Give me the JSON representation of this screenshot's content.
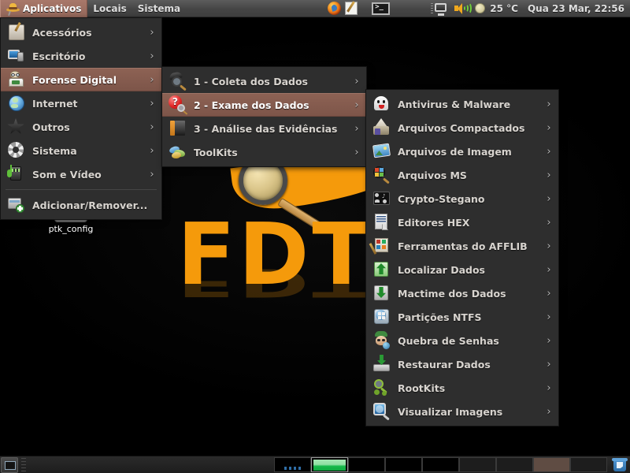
{
  "top_panel": {
    "menus": [
      {
        "label": "Aplicativos",
        "icon": "fedora-hat-icon",
        "active": true
      },
      {
        "label": "Locais",
        "icon": null,
        "active": false
      },
      {
        "label": "Sistema",
        "icon": null,
        "active": false
      }
    ],
    "launchers": [
      {
        "name": "firefox-icon",
        "label": "Firefox"
      },
      {
        "name": "text-editor-icon",
        "label": "Editor de Texto"
      },
      {
        "name": "terminal-icon",
        "label": "Terminal"
      }
    ],
    "tray": {
      "network_monitor_icon": "network-monitor-icon",
      "volume_icon": "volume-icon",
      "weather_icon": "moon-icon",
      "temperature": "25 °C",
      "clock": "Qua 23 Mar, 22:56"
    }
  },
  "menu_applications": {
    "items": [
      {
        "label": "Acessórios",
        "icon": "accessories-icon",
        "arrow": "›",
        "selected": false,
        "color1": "#e9e4da",
        "color2": "#b9b0a2"
      },
      {
        "label": "Escritório",
        "icon": "office-icon",
        "arrow": "›",
        "selected": false,
        "color1": "#4a9fe0",
        "color2": "#1c5b94"
      },
      {
        "label": "Forense Digital",
        "icon": "forensics-icon",
        "arrow": "›",
        "selected": true,
        "color1": "#d8cbb4",
        "color2": "#8c7452"
      },
      {
        "label": "Internet",
        "icon": "internet-globe-icon",
        "arrow": "›",
        "selected": false,
        "color1": "#9fd2f2",
        "color2": "#2a6fa8"
      },
      {
        "label": "Outros",
        "icon": "star-icon",
        "arrow": "›",
        "selected": false,
        "color1": "#4a4a4a",
        "color2": "#161616"
      },
      {
        "label": "Sistema",
        "icon": "gear-icon",
        "arrow": "›",
        "selected": false,
        "color1": "#efefef",
        "color2": "#a9a9a9"
      },
      {
        "label": "Som e Vídeo",
        "icon": "sound-video-icon",
        "arrow": "›",
        "selected": false,
        "color1": "#7fc45a",
        "color2": "#2d6b2d"
      }
    ],
    "separator_after_index": 6,
    "footer_item": {
      "label": "Adicionar/Remover...",
      "icon": "add-remove-icon",
      "arrow": "",
      "selected": false,
      "color1": "#d6d6d6",
      "color2": "#8f8f8f"
    }
  },
  "menu_forense_digital": {
    "items": [
      {
        "label": "1 - Coleta dos Dados",
        "icon": "collect-data-icon",
        "arrow": "›",
        "selected": false,
        "color1": "#4e4e4e",
        "color2": "#1c1c1c"
      },
      {
        "label": "2 - Exame dos Dados",
        "icon": "exam-data-icon",
        "arrow": "›",
        "selected": true,
        "color1": "#e23b3b",
        "color2": "#9c1111"
      },
      {
        "label": "3 - Análise das Evidências",
        "icon": "analysis-icon",
        "arrow": "›",
        "selected": false,
        "color1": "#e08a2a",
        "color2": "#4a4a4a"
      },
      {
        "label": "ToolKits",
        "icon": "toolkits-icon",
        "arrow": "›",
        "selected": false,
        "color1": "#7fb3e0",
        "color2": "#5a9a3a"
      }
    ]
  },
  "menu_exame_dos_dados": {
    "items": [
      {
        "label": "Antivirus & Malware",
        "icon": "ghost-icon",
        "arrow": "›",
        "color1": "#f2f2f2",
        "color2": "#c9c9c9"
      },
      {
        "label": "Arquivos Compactados",
        "icon": "archive-icon",
        "arrow": "›",
        "color1": "#e8e3d8",
        "color2": "#9b8d74"
      },
      {
        "label": "Arquivos de Imagem",
        "icon": "image-file-icon",
        "arrow": "›",
        "color1": "#73c6e8",
        "color2": "#3d7fb0"
      },
      {
        "label": "Arquivos MS",
        "icon": "ms-files-icon",
        "arrow": "›",
        "color1": "#9fd8f2",
        "color2": "#2f6f9f"
      },
      {
        "label": "Crypto-Stegano",
        "icon": "crypto-stegano-icon",
        "arrow": "›",
        "color1": "#3a3a3a",
        "color2": "#0e0e0e"
      },
      {
        "label": "Editores HEX",
        "icon": "hex-editor-icon",
        "arrow": "›",
        "color1": "#f1f1f1",
        "color2": "#cfcfcf"
      },
      {
        "label": "Ferramentas do AFFLIB",
        "icon": "afflib-tools-icon",
        "arrow": "›",
        "color1": "#e6e0d2",
        "color2": "#b04a3c"
      },
      {
        "label": "Localizar Dados",
        "icon": "find-data-icon",
        "arrow": "›",
        "color1": "#7fdf6a",
        "color2": "#2a8f2a"
      },
      {
        "label": "Mactime dos Dados",
        "icon": "mactime-icon",
        "arrow": "›",
        "color1": "#7fdf6a",
        "color2": "#2a8f2a"
      },
      {
        "label": "Partições NTFS",
        "icon": "ntfs-partitions-icon",
        "arrow": "›",
        "color1": "#bcd6e8",
        "color2": "#5a7f9c"
      },
      {
        "label": "Quebra de Senhas",
        "icon": "password-crack-icon",
        "arrow": "›",
        "color1": "#5ac46a",
        "color2": "#1f7a9c"
      },
      {
        "label": "Restaurar Dados",
        "icon": "restore-data-icon",
        "arrow": "›",
        "color1": "#d9d9d9",
        "color2": "#2a8f2a"
      },
      {
        "label": "RootKits",
        "icon": "rootkits-icon",
        "arrow": "›",
        "color1": "#8fbf3a",
        "color2": "#4a7a1a"
      },
      {
        "label": "Visualizar Imagens",
        "icon": "view-images-icon",
        "arrow": "›",
        "color1": "#5aa8e0",
        "color2": "#1d5f9c"
      }
    ]
  },
  "desktop": {
    "icons": [
      {
        "label": "ptk_config",
        "icon": "script-file-icon"
      }
    ],
    "wallpaper_logo_text": "FDTK",
    "accent_color": "#f59a0b"
  },
  "bottom_panel": {
    "show_desktop_icon": "show-desktop-icon",
    "workspaces": [
      {
        "name": "workspace-1",
        "state": "windows"
      },
      {
        "name": "workspace-2",
        "state": "active"
      },
      {
        "name": "workspace-3",
        "state": "empty"
      },
      {
        "name": "workspace-4",
        "state": "empty"
      },
      {
        "name": "workspace-5",
        "state": "empty"
      },
      {
        "name": "workspace-6",
        "state": "grey"
      },
      {
        "name": "workspace-7",
        "state": "grey"
      },
      {
        "name": "workspace-8",
        "state": "brown"
      },
      {
        "name": "workspace-9",
        "state": "grey"
      }
    ],
    "trash_icon": "trash-icon"
  },
  "colors": {
    "menu_bg": "#2e2e2e",
    "menu_text": "#d8d4cf",
    "highlight": "#8d6254",
    "panel_bg": "#454545",
    "accent_orange": "#f59a0b"
  }
}
